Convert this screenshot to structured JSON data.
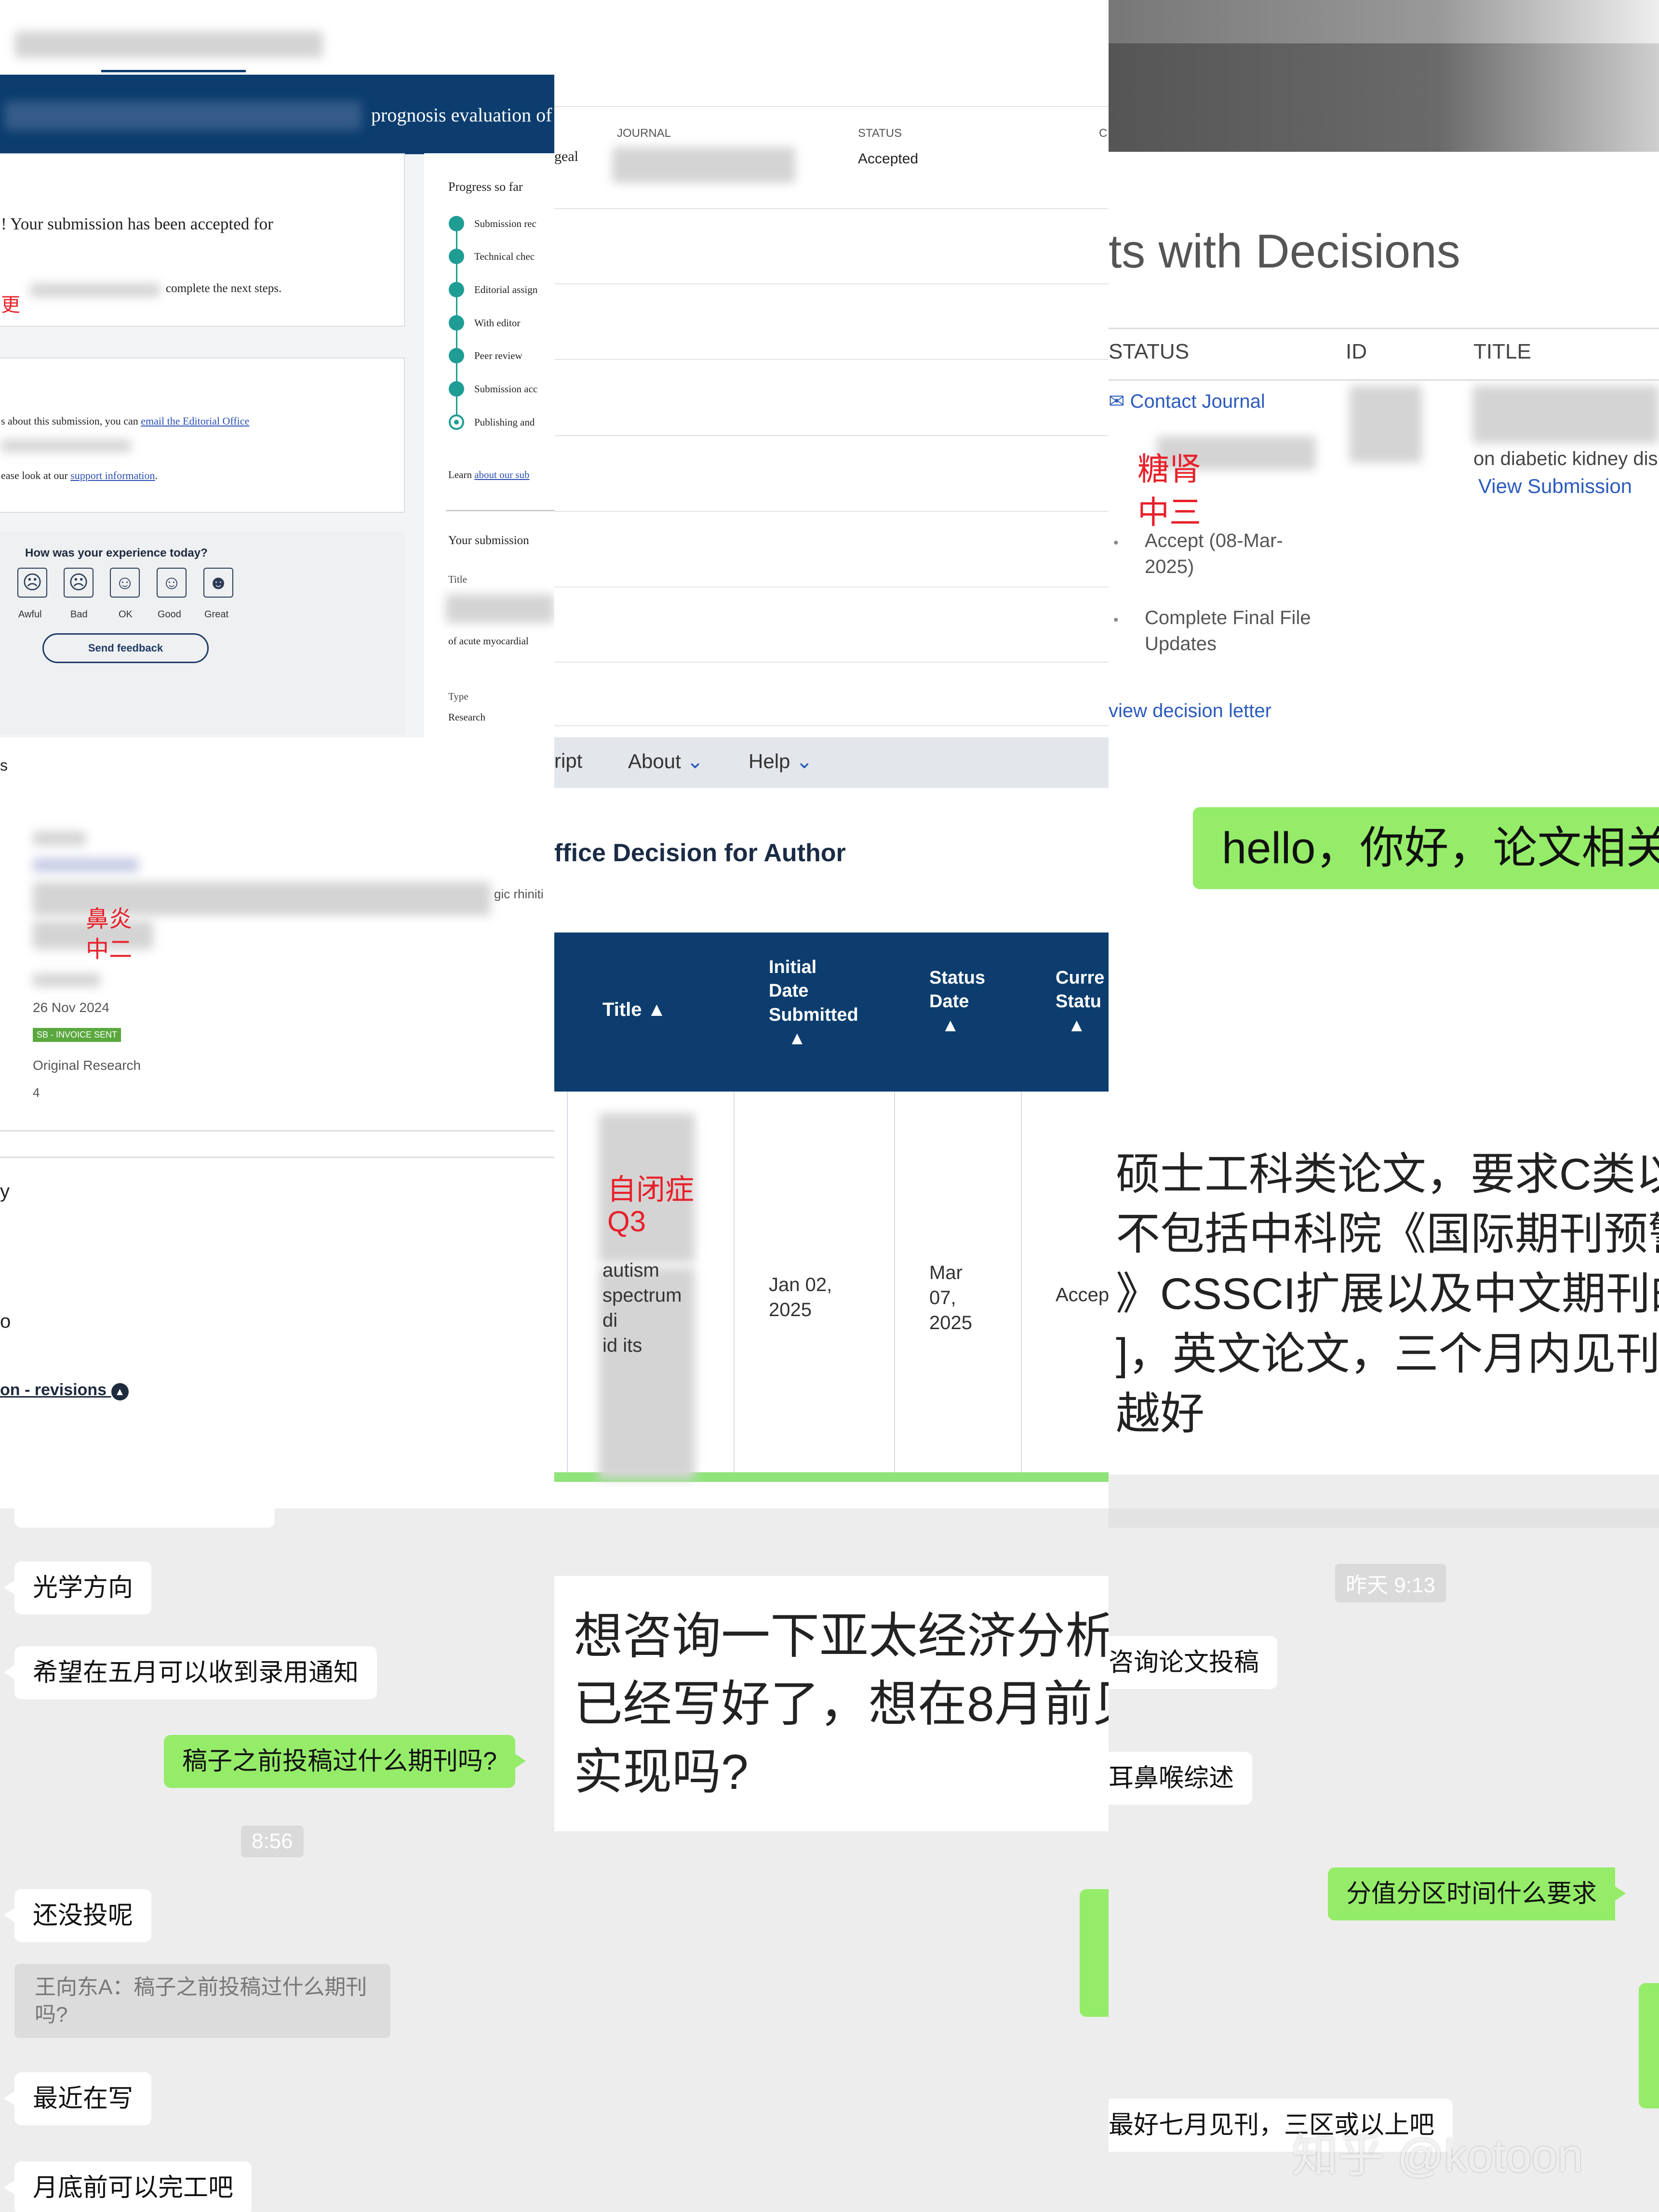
{
  "p1": {
    "banner_title": "prognosis evaluation of",
    "accepted_msg": "! Your submission has been accepted for",
    "next_steps": "complete the next steps.",
    "red_mark": "更",
    "contact_prefix": "s about this submission, you can ",
    "contact_link": "email the Editorial Office",
    "support_prefix": "ease look at our ",
    "support_link": "support information",
    "support_suffix": ".",
    "progress_title": "Progress so far",
    "progress": [
      "Submission rec",
      "Technical chec",
      "Editorial assign",
      "With editor",
      "Peer review",
      "Submission acc",
      "Publishing and"
    ],
    "learn_prefix": "Learn ",
    "learn_link": "about our sub",
    "side_fragment": "geal",
    "your_submission": "Your submission",
    "title_label": "Title",
    "title_value": "of acute myocardial",
    "type_label": "Type",
    "type_value": "Research",
    "feedback_q": "How was your experience today?",
    "ratings": [
      "Awful",
      "Bad",
      "OK",
      "Good",
      "Great"
    ],
    "send_feedback": "Send feedback"
  },
  "p2": {
    "journal_label": "JOURNAL",
    "status_label": "STATUS",
    "status_value": "Accepted",
    "c_fragment": "C"
  },
  "p3": {
    "heading": "ts with Decisions",
    "col_status": "STATUS",
    "col_id": "ID",
    "col_title": "TITLE",
    "contact_journal": "Contact Journal",
    "red1": "糖肾",
    "red2": "中三",
    "title_frag": "on diabetic kidney dis",
    "view_submission": "View Submission",
    "accept_line1": "Accept (08-Mar-",
    "accept_line2": "2025)",
    "cff_line1": "Complete Final File",
    "cff_line2": "Updates",
    "view_letter": "view decision letter"
  },
  "p4": {
    "s_fragment": "s",
    "rhinitis": "gic rhiniti",
    "red1": "鼻炎",
    "red2": "中二",
    "date": "26 Nov 2024",
    "badge": "SB - INVOICE SENT",
    "type": "Original Research",
    "num": "4",
    "y_fragment": "y",
    "o_fragment": "o",
    "revisions": "on - revisions"
  },
  "p5": {
    "menu": [
      "ript",
      "About",
      "Help"
    ],
    "heading": "ffice Decision for Author",
    "headers": {
      "title": "Title",
      "initial": [
        "Initial",
        "Date",
        "Submitted"
      ],
      "status": [
        "Status",
        "Date"
      ],
      "current": [
        "Curre",
        "Statu"
      ]
    },
    "red1": "自闭症",
    "red2": "Q3",
    "autism": [
      "autism",
      "spectrum",
      "di",
      "id its"
    ],
    "initial_date": [
      "Jan 02,",
      "2025"
    ],
    "status_date": [
      "Mar",
      "07,",
      "2025"
    ],
    "current_status": "Accep"
  },
  "p6": {
    "hello": "hello，你好，论文相关",
    "lines": [
      "硕士工科类论文，要求C类以",
      "不包括中科院《国际期刊预警",
      "》CSSCI扩展以及中文期刊的",
      "]，英文论文，三个月内见刊，",
      "越好"
    ]
  },
  "p7": {
    "b1": "光学方向",
    "b2": "希望在五月可以收到录用通知",
    "b3": "稿子之前投稿过什么期刊吗?",
    "time": "8:56",
    "b4": "还没投呢",
    "quote": [
      "王向东A：稿子之前投稿过什么期刊",
      "吗?"
    ],
    "b5": "最近在写",
    "b6": "月底前可以完工吧"
  },
  "p8": {
    "lines": [
      "想咨询一下亚太经济分析",
      "已经写好了，想在8月前见",
      "实现吗?"
    ]
  },
  "p9": {
    "time": "昨天 9:13",
    "b1": "咨询论文投稿",
    "b2": "耳鼻喉综述",
    "b3": "分值分区时间什么要求",
    "b4": "最好七月见刊，三区或以上吧",
    "watermark": "知乎 @kotoon"
  }
}
